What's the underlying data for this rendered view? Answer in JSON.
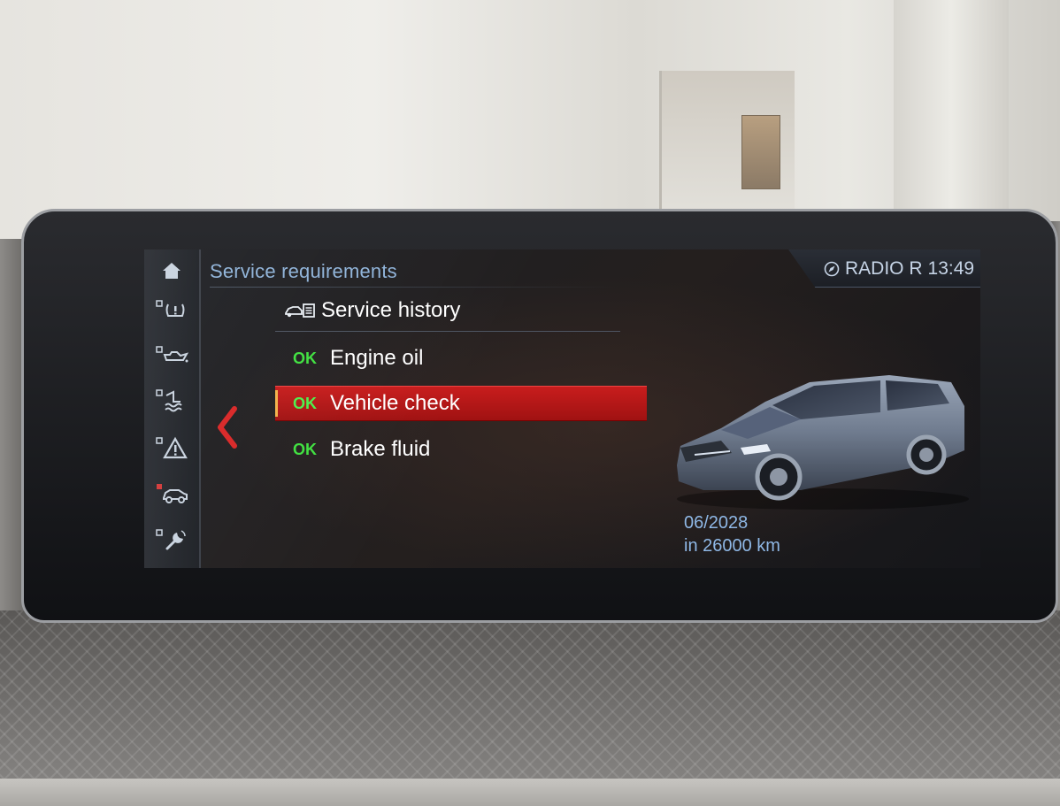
{
  "screen": {
    "title": "Service requirements",
    "status": {
      "source": "RADIO R",
      "time": "13:49"
    },
    "menu": [
      {
        "status": "",
        "label": "Service history"
      },
      {
        "status": "OK",
        "label": "Engine oil"
      },
      {
        "status": "OK",
        "label": "Vehicle check"
      },
      {
        "status": "OK",
        "label": "Brake fluid"
      }
    ],
    "selected_index": 2,
    "due": {
      "date": "06/2028",
      "distance": "in 26000 km"
    },
    "rail_icons": [
      "home-icon",
      "tire-pressure-icon",
      "oil-can-icon",
      "coolant-icon",
      "warning-triangle-icon",
      "car-service-icon",
      "wrench-icon"
    ]
  },
  "colors": {
    "accent_selected": "#b71717",
    "ok_green": "#3fe03f",
    "title_blue": "#8fb3d9"
  }
}
